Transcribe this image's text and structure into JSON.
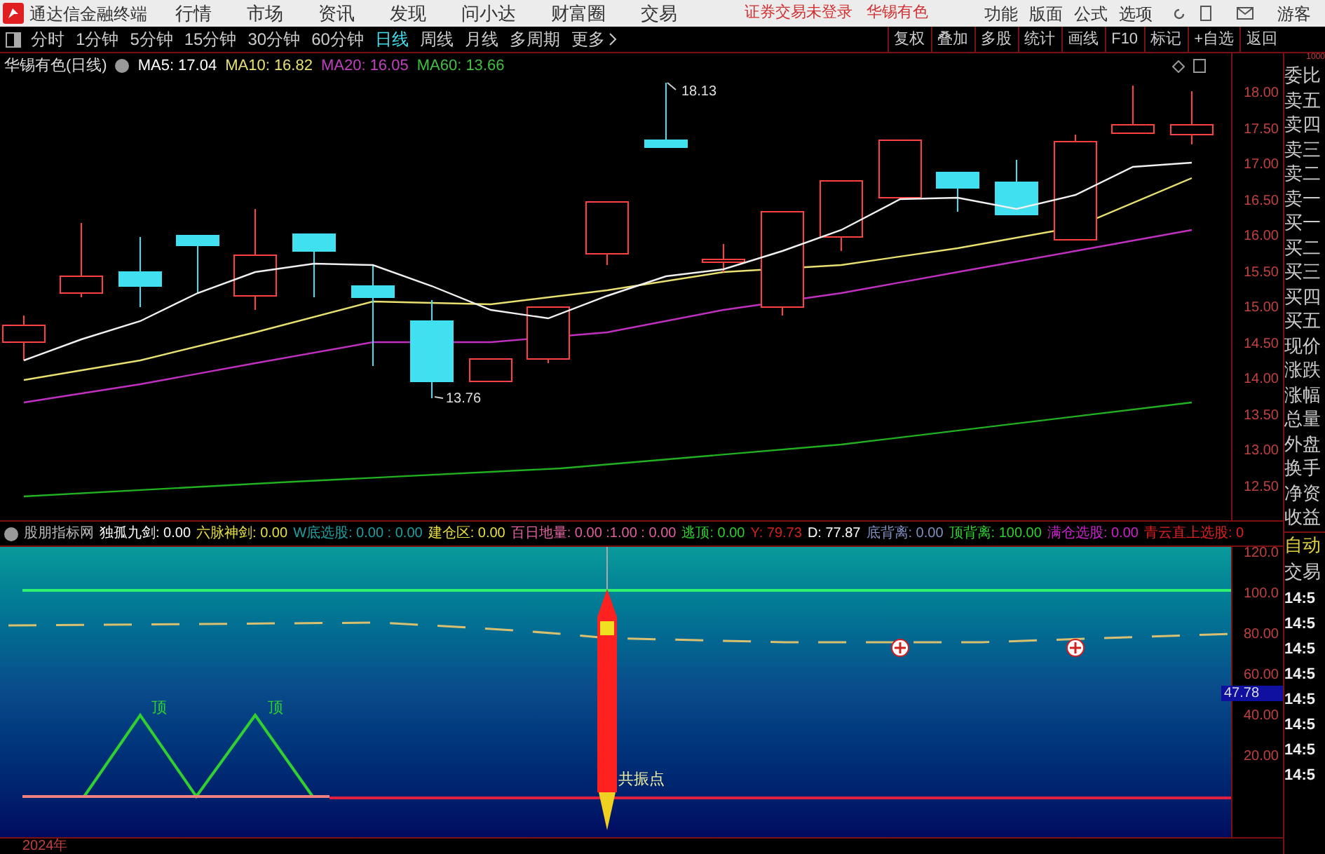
{
  "app": {
    "title": "通达信金融终端"
  },
  "menu": [
    "行情",
    "市场",
    "资讯",
    "发现",
    "问小达",
    "财富圈",
    "交易"
  ],
  "status_texts": [
    "证券交易未登录",
    "华锡有色"
  ],
  "right_menu": [
    "功能",
    "版面",
    "公式",
    "选项"
  ],
  "user": "游客",
  "periods": [
    {
      "label": "分时",
      "selected": false
    },
    {
      "label": "1分钟",
      "selected": false
    },
    {
      "label": "5分钟",
      "selected": false
    },
    {
      "label": "15分钟",
      "selected": false
    },
    {
      "label": "30分钟",
      "selected": false
    },
    {
      "label": "60分钟",
      "selected": false
    },
    {
      "label": "日线",
      "selected": true
    },
    {
      "label": "周线",
      "selected": false
    },
    {
      "label": "月线",
      "selected": false
    },
    {
      "label": "多周期",
      "selected": false
    },
    {
      "label": "更多",
      "selected": false
    }
  ],
  "tools": [
    "复权",
    "叠加",
    "多股",
    "统计",
    "画线",
    "F10",
    "标记",
    "+自选",
    "返回"
  ],
  "legend": {
    "title": "华锡有色(日线)",
    "items": [
      {
        "text": "MA5: 17.04",
        "color": "#ffffff"
      },
      {
        "text": "MA10: 16.82",
        "color": "#e8e070"
      },
      {
        "text": "MA20: 16.05",
        "color": "#c040c0"
      },
      {
        "text": "MA60: 13.66",
        "color": "#40c040"
      }
    ]
  },
  "price_axis": [
    "18.00",
    "17.50",
    "17.00",
    "16.50",
    "16.00",
    "15.50",
    "15.00",
    "14.50",
    "14.00",
    "13.50",
    "13.00",
    "12.50"
  ],
  "annotations": [
    {
      "text": "18.13"
    },
    {
      "text": "13.76"
    }
  ],
  "indicator": {
    "title": "股朋指标网",
    "items": [
      {
        "text": "独孤九剑: 0.00",
        "color": "#ffffff"
      },
      {
        "text": "六脉神剑: 0.00",
        "color": "#e8e040"
      },
      {
        "text": "W底选股: 0.00 : 0.00",
        "color": "#20a0a0"
      },
      {
        "text": "建仓区: 0.00",
        "color": "#e8e040"
      },
      {
        "text": "百日地量: 0.00 :1.00 : 0.00",
        "color": "#e060a0"
      },
      {
        "text": "逃顶: 0.00",
        "color": "#30d030"
      },
      {
        "text": "Y: 79.73",
        "color": "#d02020"
      },
      {
        "text": "D: 77.87",
        "color": "#ffffff"
      },
      {
        "text": "底背离: 0.00",
        "color": "#8090c0"
      },
      {
        "text": "顶背离: 100.00",
        "color": "#30d030"
      },
      {
        "text": "满仓选股: 0.00",
        "color": "#d020d0"
      },
      {
        "text": "青云直上选股: 0",
        "color": "#e02020"
      }
    ],
    "axis": [
      "120.0",
      "100.0",
      "80.00",
      "60.00",
      "40.00",
      "20.00"
    ],
    "current_value": "47.78",
    "peak_labels": [
      "顶",
      "顶"
    ],
    "signal_label": "共振点"
  },
  "date_label": "2024年",
  "quote_panel": {
    "top_value": "1000",
    "fields": [
      "委比",
      "卖五",
      "卖四",
      "卖三",
      "卖二",
      "卖一",
      "买一",
      "买二",
      "买三",
      "买四",
      "买五",
      "现价",
      "涨跌",
      "涨幅",
      "总量",
      "外盘",
      "换手",
      "净资",
      "收益"
    ],
    "mode": "自动",
    "section": "交易",
    "ticks": [
      "14:5",
      "14:5",
      "14:5",
      "14:5",
      "14:5",
      "14:5",
      "14:5",
      "14:5"
    ]
  }
}
